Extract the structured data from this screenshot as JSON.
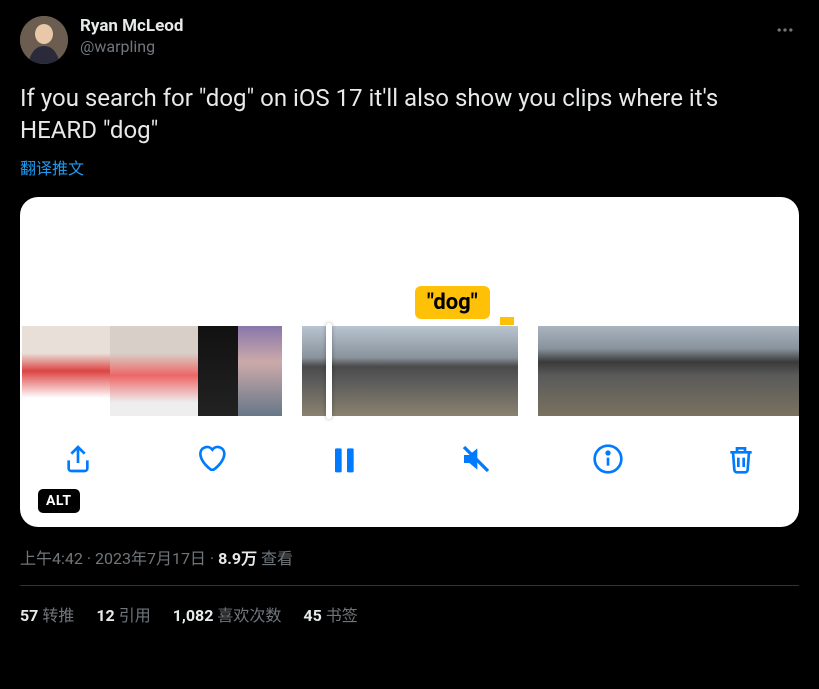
{
  "user": {
    "display_name": "Ryan McLeod",
    "handle": "@warpling"
  },
  "tweet": {
    "text": "If you search for \"dog\" on iOS 17 it'll also show you clips where it's HEARD \"dog\"",
    "translate_label": "翻译推文"
  },
  "media": {
    "caption_label": "\"dog\"",
    "alt_badge": "ALT"
  },
  "meta": {
    "time": "上午4:42",
    "dot1": " · ",
    "date": "2023年7月17日",
    "dot2": " · ",
    "views_count": "8.9万",
    "views_label": " 查看"
  },
  "stats": {
    "retweets_count": "57",
    "retweets_label": "转推",
    "quotes_count": "12",
    "quotes_label": "引用",
    "likes_count": "1,082",
    "likes_label": "喜欢次数",
    "bookmarks_count": "45",
    "bookmarks_label": "书签"
  }
}
